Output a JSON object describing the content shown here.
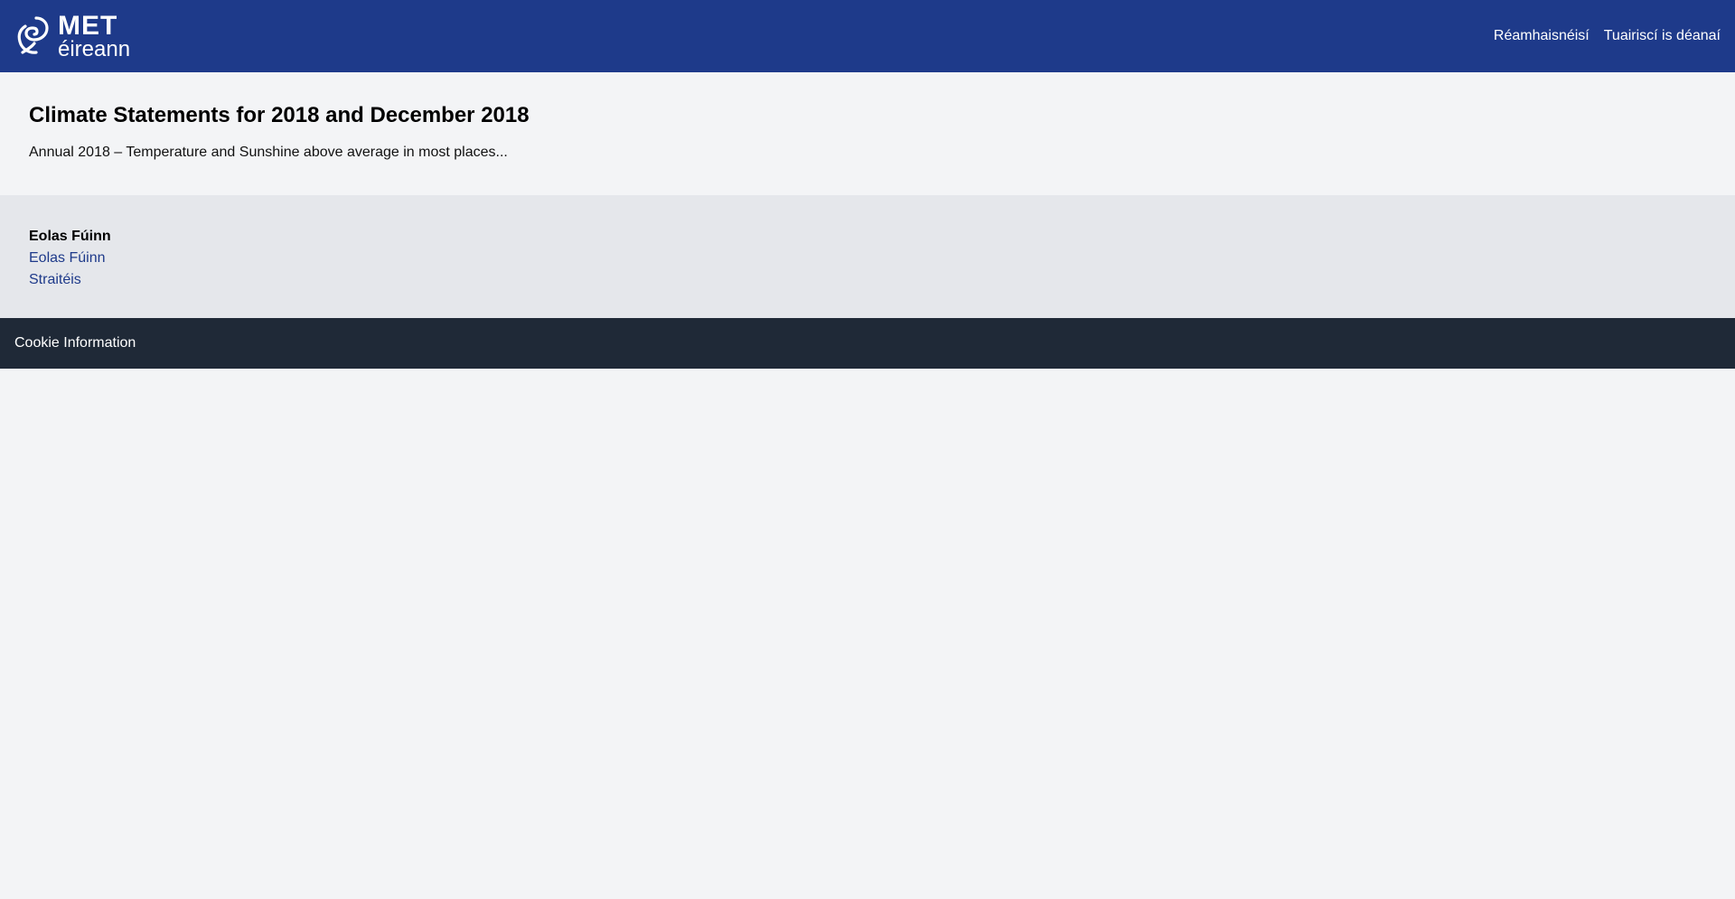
{
  "header": {
    "logo": {
      "primary": "MET",
      "secondary": "éireann"
    },
    "nav": [
      {
        "label": "Réamhaisnéisí"
      },
      {
        "label": "Tuairiscí is déanaí"
      }
    ]
  },
  "intro": {
    "title": "Climate Statements for 2018 and December 2018",
    "subtitle": "Annual 2018 – Temperature and Sunshine above average in most places..."
  },
  "info": {
    "title": "Eolas Fúinn",
    "links": [
      {
        "label": "Eolas Fúinn"
      },
      {
        "label": "Straitéis"
      }
    ]
  },
  "cookie": {
    "label": "Cookie Information"
  }
}
